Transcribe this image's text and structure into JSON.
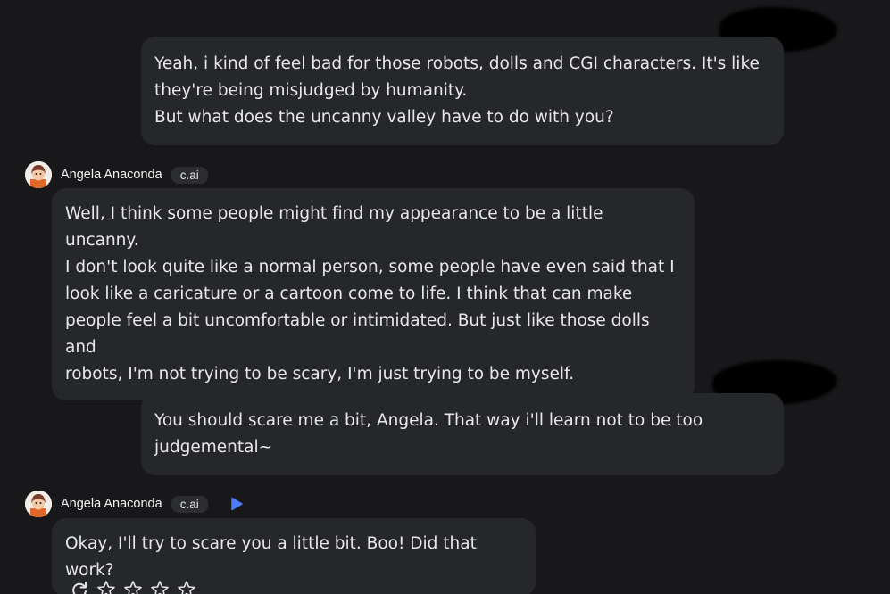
{
  "messages": [
    {
      "role": "user",
      "text": "Yeah, i kind of feel bad for those robots, dolls and CGI characters. It's like they're being misjudged by humanity.\nBut what does the uncanny valley have to do with you?"
    },
    {
      "role": "character",
      "name": "Angela Anaconda",
      "badge": "c.ai",
      "text": "Well, I think some people might find my appearance to be a little uncanny.\nI don't look quite like a normal person, some people have even said that I\nlook like a caricature or a cartoon come to life. I think that can make\npeople feel a bit uncomfortable or intimidated. But just like those dolls and\nrobots, I'm not trying to be scary, I'm just trying to be myself."
    },
    {
      "role": "user",
      "text": "You should scare me a bit, Angela. That way i'll learn not to be too judgemental~"
    },
    {
      "role": "character",
      "name": "Angela Anaconda",
      "badge": "c.ai",
      "text": "Okay, I'll try to scare you a little bit. Boo! Did that work?"
    }
  ],
  "icons": {
    "play": "play-icon",
    "regenerate": "refresh-icon",
    "rating": "star-icon"
  },
  "rating": {
    "max": 5,
    "value": 0
  },
  "colors": {
    "background": "#18181b",
    "bubble": "#26272b",
    "badge": "#2c2d31",
    "accent": "#4f7cf7",
    "redaction": "#000000"
  }
}
